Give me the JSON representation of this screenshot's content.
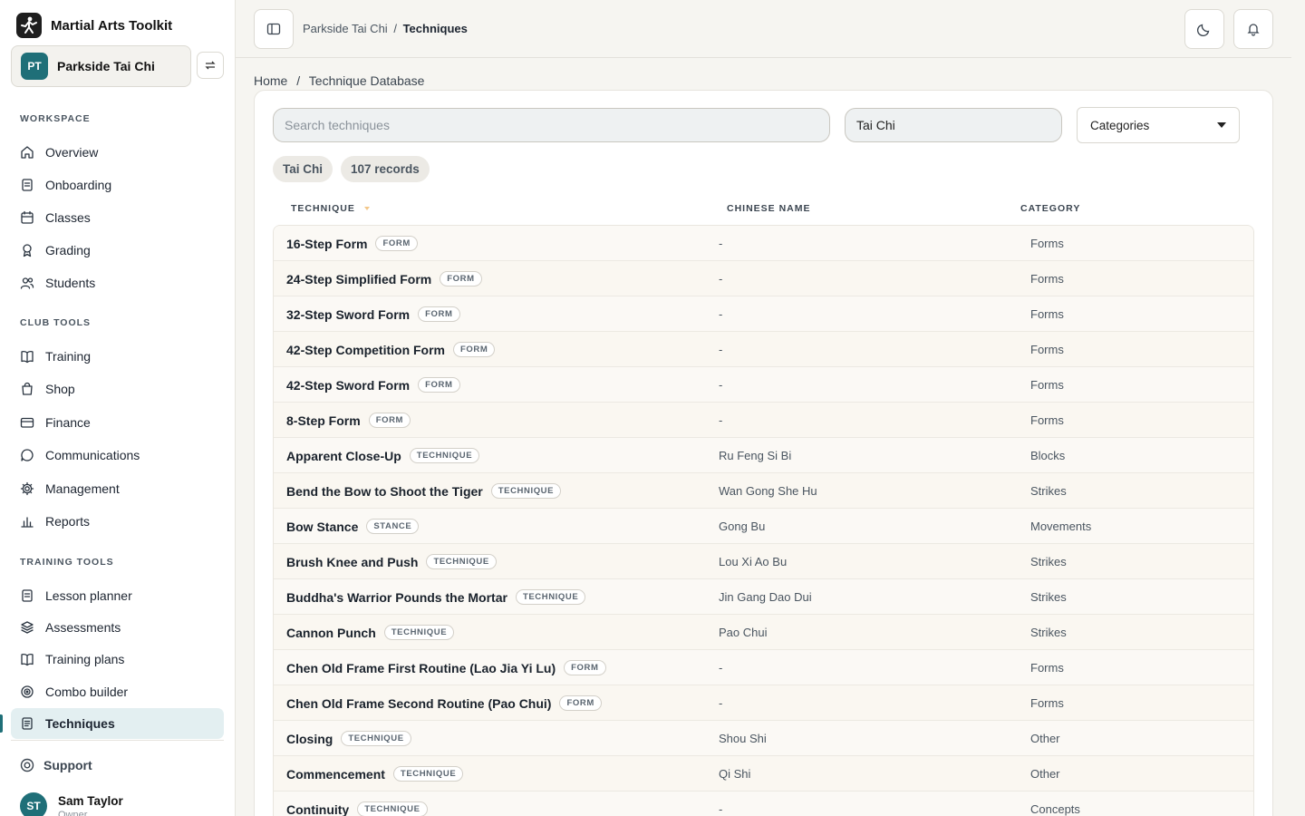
{
  "app": {
    "name": "Martial Arts Toolkit"
  },
  "club": {
    "initials": "PT",
    "name": "Parkside Tai Chi"
  },
  "sidebar": {
    "workspace_title": "WORKSPACE",
    "workspace": [
      {
        "label": "Overview",
        "icon": "home-icon"
      },
      {
        "label": "Onboarding",
        "icon": "clipboard-icon"
      },
      {
        "label": "Classes",
        "icon": "calendar-icon"
      },
      {
        "label": "Grading",
        "icon": "award-icon"
      },
      {
        "label": "Students",
        "icon": "users-icon"
      }
    ],
    "club_tools_title": "CLUB TOOLS",
    "club_tools": [
      {
        "label": "Training",
        "icon": "book-icon"
      },
      {
        "label": "Shop",
        "icon": "bag-icon"
      },
      {
        "label": "Finance",
        "icon": "card-icon"
      },
      {
        "label": "Communications",
        "icon": "chat-icon"
      },
      {
        "label": "Management",
        "icon": "gear-icon"
      },
      {
        "label": "Reports",
        "icon": "bar-chart-icon"
      }
    ],
    "training_tools_title": "TRAINING TOOLS",
    "training_tools": [
      {
        "label": "Lesson planner",
        "icon": "clipboard-icon"
      },
      {
        "label": "Assessments",
        "icon": "layers-icon"
      },
      {
        "label": "Training plans",
        "icon": "book-icon"
      },
      {
        "label": "Combo builder",
        "icon": "target-icon"
      },
      {
        "label": "Techniques",
        "icon": "document-icon",
        "active": true
      }
    ],
    "support_label": "Support",
    "user": {
      "initials": "ST",
      "name": "Sam Taylor",
      "role": "Owner"
    }
  },
  "topbar": {
    "crumb_parent": "Parkside Tai Chi",
    "crumb_sep": "/",
    "crumb_current": "Techniques"
  },
  "breadcrumb": {
    "home": "Home",
    "sep": "/",
    "current": "Technique Database"
  },
  "search": {
    "placeholder": "Search techniques",
    "value": ""
  },
  "filter": {
    "value": "Tai Chi"
  },
  "categories_select": {
    "label": "Categories"
  },
  "chips": {
    "style": "Tai Chi",
    "count": "107 records"
  },
  "table": {
    "headers": {
      "technique": "TECHNIQUE",
      "chinese": "CHINESE NAME",
      "category": "CATEGORY"
    },
    "rows": [
      {
        "name": "16-Step Form",
        "type": "FORM",
        "chinese": "-",
        "category": "Forms"
      },
      {
        "name": "24-Step Simplified Form",
        "type": "FORM",
        "chinese": "-",
        "category": "Forms"
      },
      {
        "name": "32-Step Sword Form",
        "type": "FORM",
        "chinese": "-",
        "category": "Forms"
      },
      {
        "name": "42-Step Competition Form",
        "type": "FORM",
        "chinese": "-",
        "category": "Forms"
      },
      {
        "name": "42-Step Sword Form",
        "type": "FORM",
        "chinese": "-",
        "category": "Forms"
      },
      {
        "name": "8-Step Form",
        "type": "FORM",
        "chinese": "-",
        "category": "Forms"
      },
      {
        "name": "Apparent Close-Up",
        "type": "TECHNIQUE",
        "chinese": "Ru Feng Si Bi",
        "category": "Blocks"
      },
      {
        "name": "Bend the Bow to Shoot the Tiger",
        "type": "TECHNIQUE",
        "chinese": "Wan Gong She Hu",
        "category": "Strikes"
      },
      {
        "name": "Bow Stance",
        "type": "STANCE",
        "chinese": "Gong Bu",
        "category": "Movements"
      },
      {
        "name": "Brush Knee and Push",
        "type": "TECHNIQUE",
        "chinese": "Lou Xi Ao Bu",
        "category": "Strikes"
      },
      {
        "name": "Buddha's Warrior Pounds the Mortar",
        "type": "TECHNIQUE",
        "chinese": "Jin Gang Dao Dui",
        "category": "Strikes"
      },
      {
        "name": "Cannon Punch",
        "type": "TECHNIQUE",
        "chinese": "Pao Chui",
        "category": "Strikes"
      },
      {
        "name": "Chen Old Frame First Routine (Lao Jia Yi Lu)",
        "type": "FORM",
        "chinese": "-",
        "category": "Forms"
      },
      {
        "name": "Chen Old Frame Second Routine (Pao Chui)",
        "type": "FORM",
        "chinese": "-",
        "category": "Forms"
      },
      {
        "name": "Closing",
        "type": "TECHNIQUE",
        "chinese": "Shou Shi",
        "category": "Other"
      },
      {
        "name": "Commencement",
        "type": "TECHNIQUE",
        "chinese": "Qi Shi",
        "category": "Other"
      },
      {
        "name": "Continuity",
        "type": "TECHNIQUE",
        "chinese": "-",
        "category": "Concepts"
      }
    ]
  },
  "colors": {
    "accent": "#1f6f78",
    "active_bg": "#e3eff1"
  }
}
